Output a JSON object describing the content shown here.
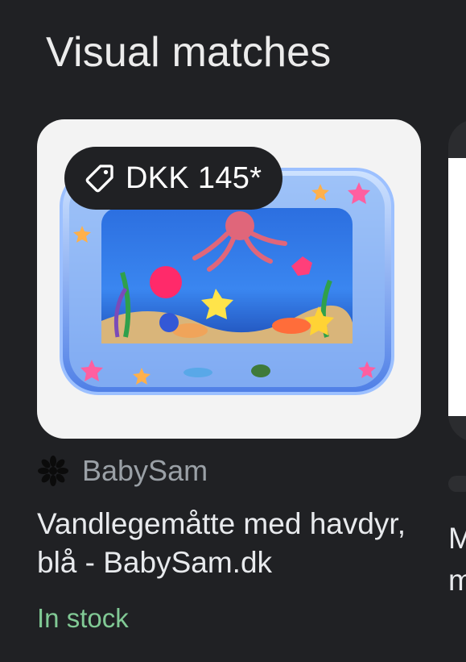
{
  "section": {
    "title": "Visual matches"
  },
  "cards": [
    {
      "price": "DKK 145*",
      "source": "BabySam",
      "title": "Vandlegemåtte med havdyr, blå - BabySam.dk",
      "stock": "In stock",
      "image_icon": "water-play-mat-image",
      "colors": {
        "badge_bg": "#202124",
        "stock": "#81c995"
      }
    }
  ],
  "next_card": {
    "title_partial": "M\nm"
  }
}
